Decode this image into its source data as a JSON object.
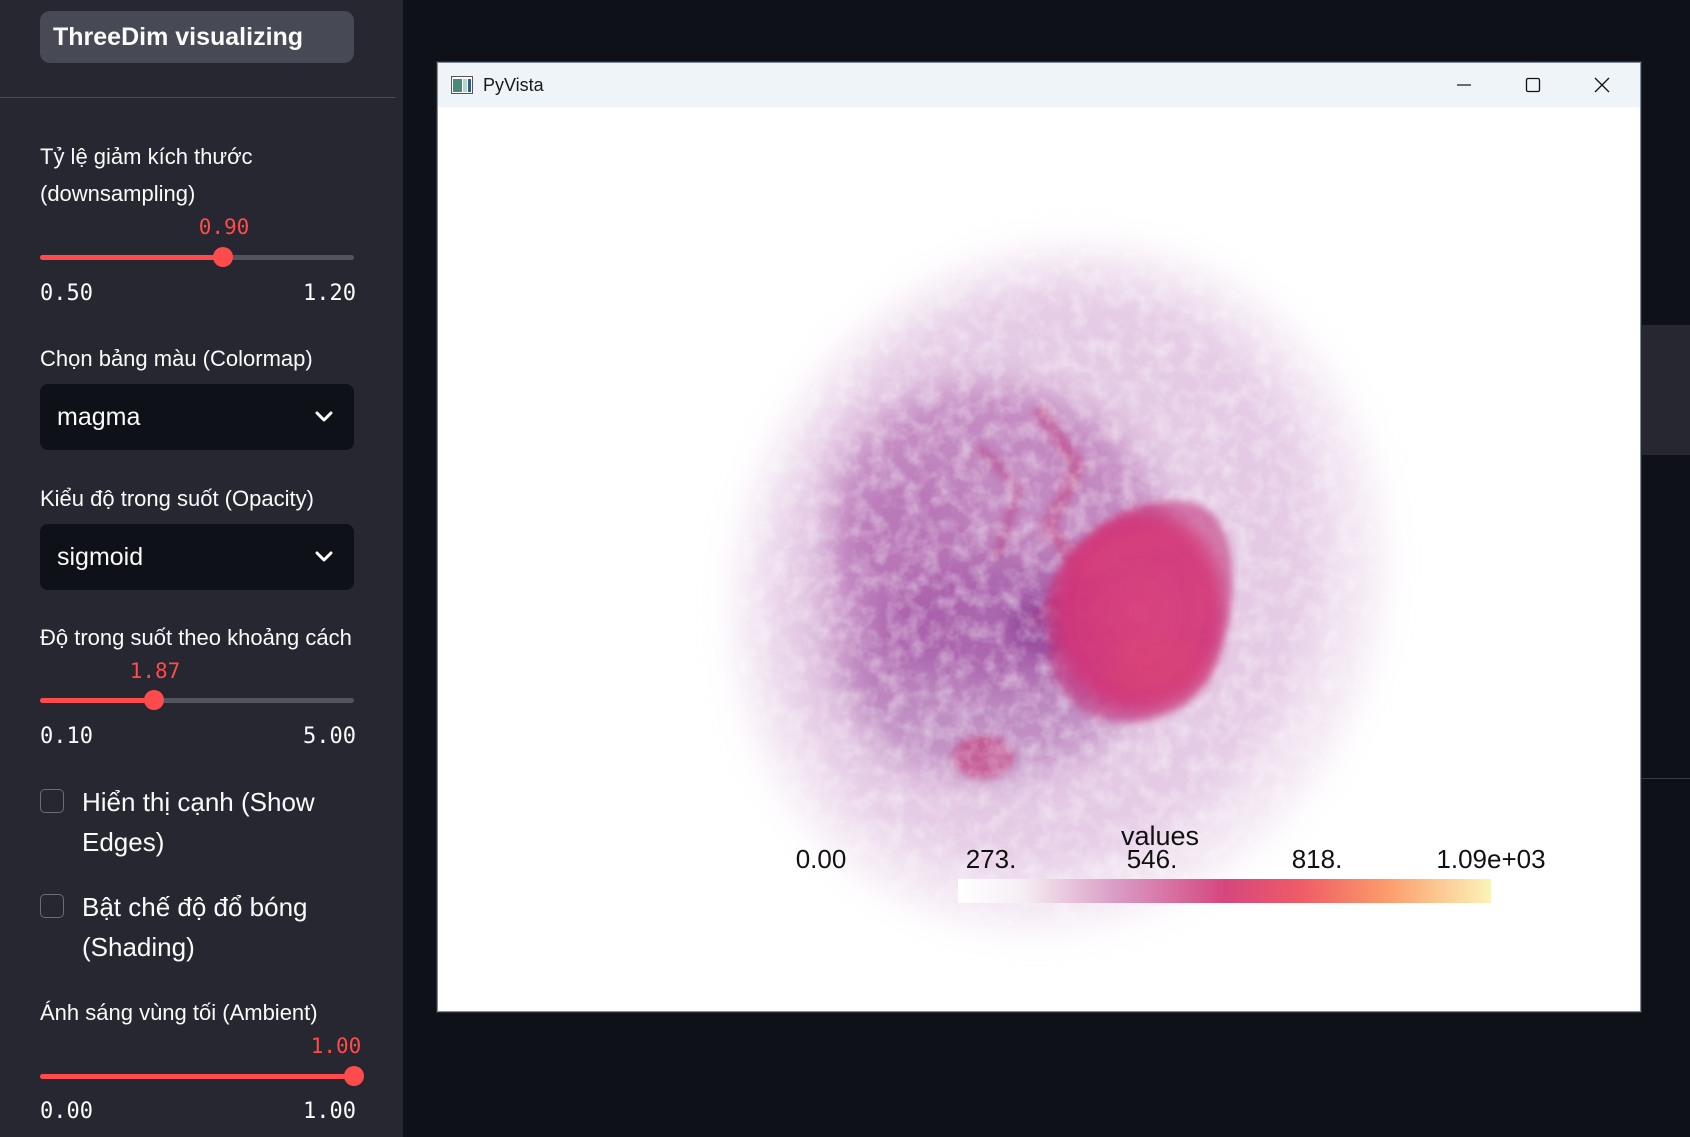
{
  "sidebar": {
    "title": "ThreeDim visualizing",
    "downsampling": {
      "label": "Tỷ lệ giảm kích thước (downsampling)",
      "value": "0.90",
      "min": "0.50",
      "max": "1.20",
      "fraction": 0.571
    },
    "colormap": {
      "label": "Chọn bảng màu (Colormap)",
      "selected": "magma"
    },
    "opacity": {
      "label": "Kiểu độ trong suốt (Opacity)",
      "selected": "sigmoid"
    },
    "distance_opacity": {
      "label": "Độ trong suốt theo khoảng cách",
      "value": "1.87",
      "min": "0.10",
      "max": "5.00",
      "fraction": 0.361
    },
    "show_edges": {
      "label": "Hiển thị cạnh (Show Edges)",
      "checked": false
    },
    "shading": {
      "label": "Bật chế độ đổ bóng (Shading)",
      "checked": false
    },
    "ambient": {
      "label": "Ánh sáng vùng tối (Ambient)",
      "value": "1.00",
      "min": "0.00",
      "max": "1.00",
      "fraction": 1.0
    }
  },
  "window": {
    "title": "PyVista",
    "icon": "pyvista-app-icon",
    "controls": [
      "minimize-icon",
      "maximize-icon",
      "close-icon"
    ]
  },
  "scalar_bar": {
    "title": "values",
    "labels": [
      "0.00",
      "273.",
      "546.",
      "818.",
      "1.09e+03"
    ],
    "colormap": "magma"
  },
  "colors": {
    "accent": "#ff4b4b",
    "sidebar_bg": "#262730",
    "app_bg": "#0e1117"
  }
}
